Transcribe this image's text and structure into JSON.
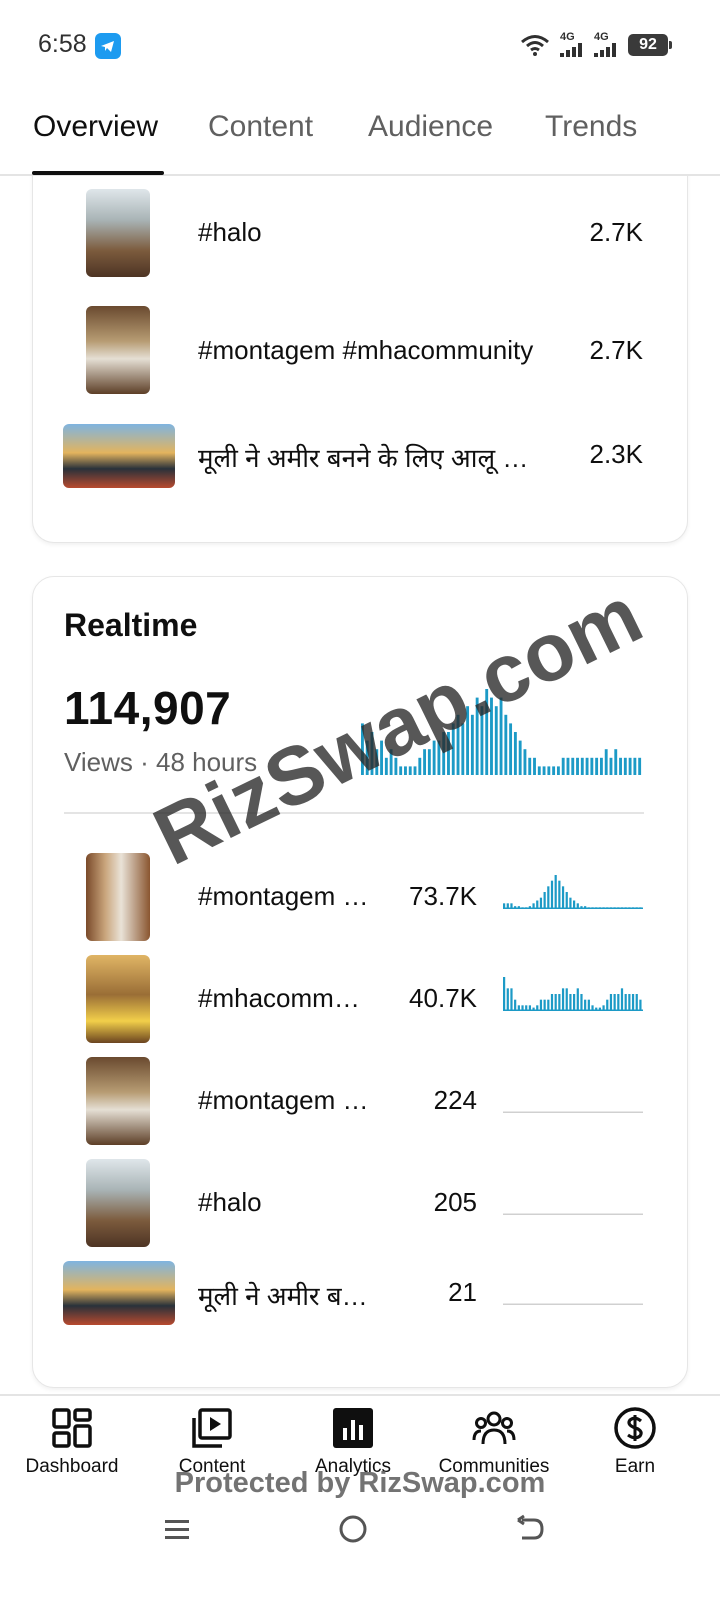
{
  "status": {
    "time": "6:58",
    "network1": "4G",
    "network2": "4G",
    "battery": "92"
  },
  "tabs": [
    {
      "label": "Overview",
      "active": true
    },
    {
      "label": "Content",
      "active": false
    },
    {
      "label": "Audience",
      "active": false
    },
    {
      "label": "Trends",
      "active": false
    }
  ],
  "top_content": [
    {
      "title": "#halo",
      "value": "2.7K",
      "thumb": "halo"
    },
    {
      "title": "#montagem #mhacommunity",
      "value": "2.7K",
      "thumb": "tree"
    },
    {
      "title": "मूली ने अमीर बनने के लिए आलू की बेटी से शादी",
      "value": "2.3K",
      "thumb": "car"
    }
  ],
  "realtime": {
    "heading": "Realtime",
    "total": "114,907",
    "subtitle": "Views · 48 hours",
    "bars": [
      6,
      4,
      5,
      3,
      4,
      2,
      3,
      2,
      1,
      1,
      1,
      1,
      2,
      3,
      3,
      4,
      4,
      5,
      5,
      6,
      7,
      6,
      8,
      7,
      9,
      8,
      10,
      9,
      8,
      9,
      7,
      6,
      5,
      4,
      3,
      2,
      2,
      1,
      1,
      1,
      1,
      1,
      2,
      2,
      2,
      2,
      2,
      2,
      2,
      2,
      2,
      3,
      2,
      3,
      2,
      2,
      2,
      2,
      2
    ],
    "items": [
      {
        "title": "#montagem #mhacommunity",
        "value": "73.7K",
        "thumb": "door",
        "bars": [
          1,
          1,
          1,
          0.5,
          0.5,
          0.3,
          0.3,
          0.5,
          1,
          1.5,
          2,
          3,
          4,
          5,
          6,
          5,
          4,
          3,
          2,
          1.5,
          1,
          0.5,
          0.5,
          0.3,
          0.3,
          0.3,
          0.3,
          0.3,
          0.3,
          0.3,
          0.3,
          0.3,
          0.3,
          0.3,
          0.3,
          0.3,
          0.3,
          0.3
        ]
      },
      {
        "title": "#mhacommunity",
        "value": "40.7K",
        "thumb": "gold",
        "bars": [
          3,
          2,
          2,
          1,
          0.5,
          0.5,
          0.5,
          0.5,
          0.3,
          0.5,
          1,
          1,
          1,
          1.5,
          1.5,
          1.5,
          2,
          2,
          1.5,
          1.5,
          2,
          1.5,
          1,
          1,
          0.5,
          0.3,
          0.3,
          0.5,
          1,
          1.5,
          1.5,
          1.5,
          2,
          1.5,
          1.5,
          1.5,
          1.5,
          1
        ]
      },
      {
        "title": "#montagem #mhacommunity",
        "value": "224",
        "thumb": "tree",
        "bars": []
      },
      {
        "title": "#halo",
        "value": "205",
        "thumb": "halo",
        "bars": []
      },
      {
        "title": "मूली ने अमीर बनने के लिए",
        "value": "21",
        "thumb": "car",
        "bars": []
      }
    ]
  },
  "bottom_nav": [
    {
      "label": "Dashboard",
      "icon": "dashboard-icon"
    },
    {
      "label": "Content",
      "icon": "content-icon"
    },
    {
      "label": "Analytics",
      "icon": "analytics-icon"
    },
    {
      "label": "Communities",
      "icon": "communities-icon"
    },
    {
      "label": "Earn",
      "icon": "earn-icon"
    }
  ],
  "watermarks": {
    "diagonal": "RizSwap.com",
    "bottom": "Protected by RizSwap.com"
  },
  "colors": {
    "accent": "#1c9ac6",
    "text": "#0f0f0f",
    "muted": "#606060"
  }
}
